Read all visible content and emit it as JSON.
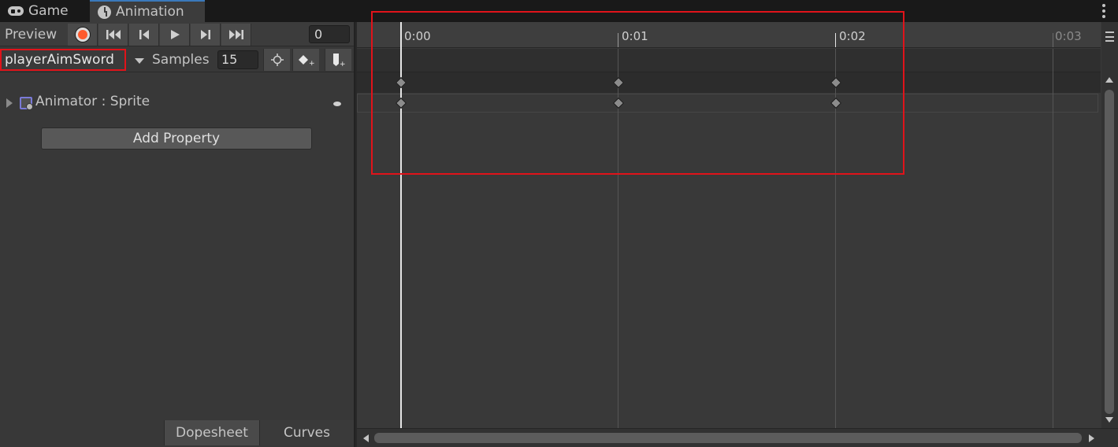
{
  "tabs": [
    {
      "label": "Game",
      "icon": "gamepad-icon",
      "active": false
    },
    {
      "label": "Animation",
      "icon": "clock-icon",
      "active": true
    }
  ],
  "toolbar": {
    "preview_label": "Preview",
    "record_icon": "record-icon",
    "first_key_icon": "skip-to-start-icon",
    "prev_key_icon": "previous-key-icon",
    "play_icon": "play-icon",
    "next_key_icon": "next-key-icon",
    "last_key_icon": "skip-to-end-icon",
    "frame_value": "0",
    "record_color": "#ff5a2d"
  },
  "clip": {
    "selected": "playerAimSword",
    "samples_label": "Samples",
    "samples_value": "15",
    "snap_icon": "keyframe-snap-icon",
    "add_keyframe_icon": "add-keyframe-icon",
    "add_event_icon": "add-event-icon"
  },
  "properties": [
    {
      "label": "Animator : Sprite",
      "icon": "animator-sprite-icon"
    }
  ],
  "add_property_label": "Add Property",
  "view_tabs": {
    "dopesheet": "Dopesheet",
    "curves": "Curves",
    "active": "dopesheet"
  },
  "timeline": {
    "ruler_labels": [
      "0:00",
      "0:01",
      "0:02",
      "0:03"
    ],
    "keyframes_at": [
      "0:00",
      "0:01",
      "0:02"
    ],
    "highlight_color": "#e0131a"
  }
}
